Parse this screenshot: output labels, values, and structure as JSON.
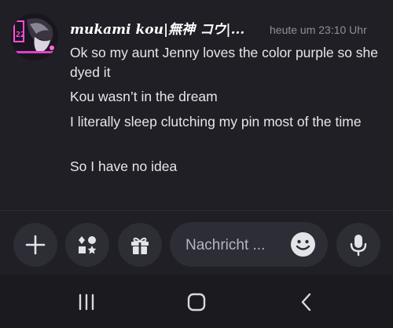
{
  "message": {
    "author": "mukami kou|無神 コウ|...",
    "timestamp": "heute um 23:10 Uhr",
    "lines": [
      "Ok so my aunt Jenny loves the color purple so she dyed it",
      "Kou wasn’t in the dream",
      "I literally sleep clutching my pin most of the time",
      "So I have no idea"
    ],
    "avatar_icon": "anime-character-avatar"
  },
  "composer": {
    "placeholder": "Nachricht ...",
    "buttons": [
      "plus-icon",
      "apps-icon",
      "gift-icon",
      "emoji-icon",
      "microphone-icon"
    ]
  },
  "system_nav": {
    "buttons": [
      "recent-apps-icon",
      "home-icon",
      "back-icon"
    ]
  },
  "colors": {
    "background": "#1f1f25",
    "button_bg": "#2c2d35",
    "text": "#e6e7ea",
    "muted": "#8e9099",
    "avatar_accent": "#e040c8"
  }
}
